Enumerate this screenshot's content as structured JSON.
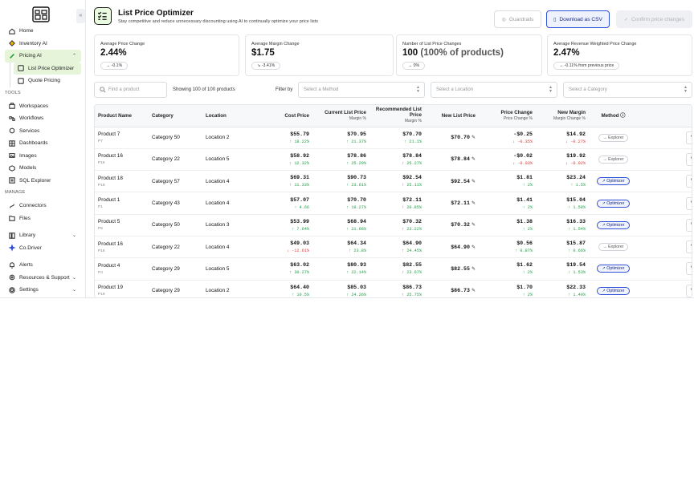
{
  "sidebar": {
    "items_top": [
      {
        "label": "Home",
        "icon": "home-icon"
      },
      {
        "label": "Inventory AI",
        "icon": "inventory-icon"
      },
      {
        "label": "Pricing AI",
        "icon": "pricing-icon"
      }
    ],
    "pricing_sub": [
      {
        "label": "List Price Optimizer",
        "selected": true
      },
      {
        "label": "Quote Pricing",
        "selected": false
      }
    ],
    "tools_label": "TOOLS",
    "tools": [
      {
        "label": "Workspaces",
        "icon": "workspaces-icon"
      },
      {
        "label": "Workflows",
        "icon": "workflows-icon"
      },
      {
        "label": "Services",
        "icon": "services-icon"
      },
      {
        "label": "Dashboards",
        "icon": "dashboards-icon"
      },
      {
        "label": "Images",
        "icon": "images-icon"
      },
      {
        "label": "Models",
        "icon": "models-icon"
      },
      {
        "label": "SQL Explorer",
        "icon": "sql-icon"
      }
    ],
    "manage_label": "MANAGE",
    "manage": [
      {
        "label": "Connectors",
        "icon": "connectors-icon"
      },
      {
        "label": "Files",
        "icon": "files-icon"
      }
    ],
    "library": "Library",
    "codriver": "Co.Driver",
    "bottom": [
      {
        "label": "Alerts",
        "icon": "alerts-icon"
      },
      {
        "label": "Resources & Support",
        "icon": "resources-icon"
      },
      {
        "label": "Settings",
        "icon": "settings-icon"
      }
    ]
  },
  "header": {
    "title": "List Price Optimizer",
    "subtitle": "Stay competitive and reduce unnecessary discounting using AI to continually optimize your price lists",
    "guardrails": "Guardrails",
    "download": "Download as CSV",
    "confirm": "Confirm price changes"
  },
  "stats": [
    {
      "label": "Average Price Change",
      "value": "2.44%",
      "value_muted": "",
      "pill": "→ -0.1%"
    },
    {
      "label": "Average Margin Change",
      "value": "$1.75",
      "value_muted": "",
      "pill": "↘ -3.41%"
    },
    {
      "label": "Number of List Price Changes",
      "value": "100",
      "value_muted": "(100% of products)",
      "pill": "→ 0%"
    },
    {
      "label": "Average Revenue Weighted Price Change",
      "value": "2.47%",
      "value_muted": "",
      "pill": "→ -0.11% from previous price"
    }
  ],
  "filters": {
    "search_placeholder": "Find a product",
    "showing": "Showing 100 of 100 products",
    "filter_by": "Filter by",
    "method_placeholder": "Select a Method",
    "location_placeholder": "Select a Location",
    "category_placeholder": "Select a Category"
  },
  "table": {
    "headers": {
      "product": "Product Name",
      "category": "Category",
      "location": "Location",
      "cost": "Cost Price",
      "current": "Current List Price",
      "current_sub": "Margin %",
      "recommended": "Recommended List Price",
      "recommended_sub": "Margin %",
      "new_price": "New List Price",
      "price_change": "Price Change",
      "price_change_sub": "Price Change %",
      "new_margin": "New Margin",
      "new_margin_sub": "Margin Change %",
      "method": "Method"
    },
    "view_label": "View",
    "rows": [
      {
        "name": "Product 7",
        "id": "P7",
        "category": "Category 50",
        "location": "Location 2",
        "cost": "$55.79",
        "cost_delta": "↑ 18.22%",
        "cost_dir": "up",
        "current": "$70.95",
        "current_margin": "↑ 21.37%",
        "recommended": "$70.70",
        "rec_margin": "↑ 21.1%",
        "new_price": "$70.70",
        "price_change": "-$0.25",
        "price_change_pct": "↓ -0.35%",
        "pc_dir": "down",
        "new_margin": "$14.92",
        "margin_change": "↓ -0.27%",
        "mc_dir": "down",
        "method": "Explorer"
      },
      {
        "name": "Product 16",
        "id": "P16",
        "category": "Category 22",
        "location": "Location 5",
        "cost": "$58.92",
        "cost_delta": "↑ 12.32%",
        "cost_dir": "up",
        "current": "$78.86",
        "current_margin": "↑ 25.29%",
        "recommended": "$78.84",
        "rec_margin": "↑ 25.27%",
        "new_price": "$78.84",
        "price_change": "-$0.02",
        "price_change_pct": "↓ -0.03%",
        "pc_dir": "down",
        "new_margin": "$19.92",
        "margin_change": "↓ -0.02%",
        "mc_dir": "down",
        "method": "Explorer"
      },
      {
        "name": "Product 18",
        "id": "P18",
        "category": "Category 57",
        "location": "Location 4",
        "cost": "$69.31",
        "cost_delta": "↑ 11.33%",
        "cost_dir": "up",
        "current": "$90.73",
        "current_margin": "↑ 23.61%",
        "recommended": "$92.54",
        "rec_margin": "↑ 25.11%",
        "new_price": "$92.54",
        "price_change": "$1.81",
        "price_change_pct": "↑ 2%",
        "pc_dir": "up",
        "new_margin": "$23.24",
        "margin_change": "↑ 1.5%",
        "mc_dir": "up",
        "method": "Optimizer"
      },
      {
        "name": "Product 1",
        "id": "P1",
        "category": "Category 43",
        "location": "Location 4",
        "cost": "$57.07",
        "cost_delta": "↑ 4.66",
        "cost_dir": "up",
        "current": "$70.70",
        "current_margin": "↑ 19.27%",
        "recommended": "$72.11",
        "rec_margin": "↑ 20.85%",
        "new_price": "$72.11",
        "price_change": "$1.41",
        "price_change_pct": "↑ 2%",
        "pc_dir": "up",
        "new_margin": "$15.04",
        "margin_change": "↑ 1.58%",
        "mc_dir": "up",
        "method": "Optimizer"
      },
      {
        "name": "Product 5",
        "id": "P5",
        "category": "Category 50",
        "location": "Location 3",
        "cost": "$53.99",
        "cost_delta": "↑ 7.64%",
        "cost_dir": "up",
        "current": "$68.94",
        "current_margin": "↑ 21.68%",
        "recommended": "$70.32",
        "rec_margin": "↑ 23.22%",
        "new_price": "$70.32",
        "price_change": "$1.38",
        "price_change_pct": "↑ 2%",
        "pc_dir": "up",
        "new_margin": "$16.33",
        "margin_change": "↑ 1.54%",
        "mc_dir": "up",
        "method": "Optimizer"
      },
      {
        "name": "Product 16",
        "id": "P16",
        "category": "Category 22",
        "location": "Location 4",
        "cost": "$49.03",
        "cost_delta": "↓ -12.61%",
        "cost_dir": "down",
        "current": "$64.34",
        "current_margin": "↑ 23.8%",
        "recommended": "$64.90",
        "rec_margin": "↑ 24.45%",
        "new_price": "$64.90",
        "price_change": "$0.56",
        "price_change_pct": "↑ 0.87%",
        "pc_dir": "up",
        "new_margin": "$15.87",
        "margin_change": "↑ 0.66%",
        "mc_dir": "up",
        "method": "Explorer"
      },
      {
        "name": "Product 4",
        "id": "P4",
        "category": "Category 29",
        "location": "Location 5",
        "cost": "$63.02",
        "cost_delta": "↑ 30.27%",
        "cost_dir": "up",
        "current": "$80.93",
        "current_margin": "↑ 22.14%",
        "recommended": "$82.55",
        "rec_margin": "↑ 23.67%",
        "new_price": "$82.55",
        "price_change": "$1.62",
        "price_change_pct": "↑ 2%",
        "pc_dir": "up",
        "new_margin": "$19.54",
        "margin_change": "↑ 1.53%",
        "mc_dir": "up",
        "method": "Optimizer"
      },
      {
        "name": "Product 19",
        "id": "P19",
        "category": "Category 29",
        "location": "Location 2",
        "cost": "$64.40",
        "cost_delta": "↑ 10.5%",
        "cost_dir": "up",
        "current": "$85.03",
        "current_margin": "↑ 24.26%",
        "recommended": "$86.73",
        "rec_margin": "↑ 25.75%",
        "new_price": "$86.73",
        "price_change": "$1.70",
        "price_change_pct": "↑ 2%",
        "pc_dir": "up",
        "new_margin": "$22.33",
        "margin_change": "↑ 1.49%",
        "mc_dir": "up",
        "method": "Optimizer"
      }
    ]
  },
  "colors": {
    "accent": "#2e4fd6",
    "active_nav": "#e6f4d9",
    "up": "#1f9d45",
    "down": "#d23a3a"
  }
}
